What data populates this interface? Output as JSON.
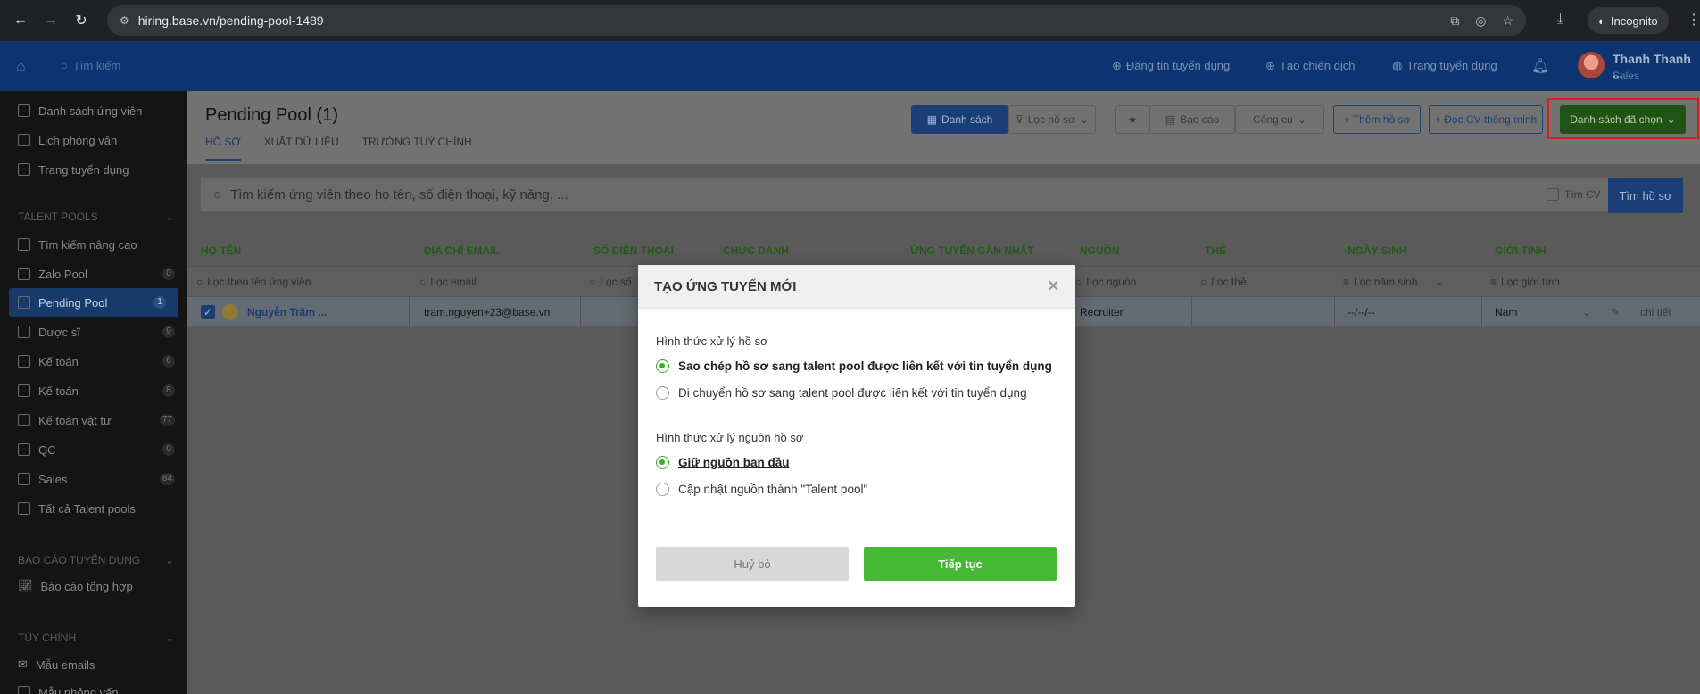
{
  "browser": {
    "url": "hiring.base.vn/pending-pool-1489",
    "incognito_label": "Incognito"
  },
  "header": {
    "search_placeholder": "Tìm kiếm",
    "links": [
      "Đăng tin tuyển dụng",
      "Tạo chiến dịch",
      "Trang tuyển dụng"
    ],
    "user_name": "Thanh Thanh ...",
    "user_role": "Sales"
  },
  "sidebar": {
    "top_items": [
      "Danh sách ứng viên",
      "Lịch phỏng vấn",
      "Trang tuyển dụng"
    ],
    "talent_pools_title": "TALENT POOLS",
    "pools": [
      {
        "label": "Tìm kiếm nâng cao",
        "count": ""
      },
      {
        "label": "Zalo Pool",
        "count": "0"
      },
      {
        "label": "Pending Pool",
        "count": "1"
      },
      {
        "label": "Dược sĩ",
        "count": "9"
      },
      {
        "label": "Kế toán",
        "count": "6"
      },
      {
        "label": "Kế toán",
        "count": "8"
      },
      {
        "label": "Kế toán vật tư",
        "count": "77"
      },
      {
        "label": "QC",
        "count": "0"
      },
      {
        "label": "Sales",
        "count": "84"
      },
      {
        "label": "Tất cả Talent pools",
        "count": ""
      }
    ],
    "reports_title": "BÁO CÁO TUYỂN DỤNG",
    "report_item": "Báo cáo tổng hợp",
    "custom_title": "TÙY CHỈNH",
    "custom_items": [
      "Mẫu emails",
      "Mẫu phỏng vấn"
    ]
  },
  "main": {
    "title": "Pending Pool (1)",
    "tabs": [
      "HỒ SƠ",
      "XUẤT DỮ LIỆU",
      "TRƯỜNG TUỲ CHỈNH"
    ],
    "toolbar": {
      "list": "Danh sách",
      "filter": "Lọc hồ sơ",
      "report": "Báo cáo",
      "tools": "Công cụ",
      "add": "+ Thêm hồ sơ",
      "smart_cv": "+ Đọc CV thông minh",
      "selected": "Danh sách đã chọn"
    },
    "search_placeholder": "Tìm kiếm ứng viên theo họ tên, số điện thoại, kỹ năng, ...",
    "cv_check_label": "Tìm CV",
    "search_button": "Tìm hồ sơ",
    "columns": [
      "HỌ TÊN",
      "ĐỊA CHỈ EMAIL",
      "SỐ ĐIỆN THOẠI",
      "CHỨC DANH",
      "ỨNG TUYỂN GẦN NHẤT",
      "NGUỒN",
      "THẺ",
      "NGÀY SINH",
      "GIỚI TÍNH"
    ],
    "filters": [
      "Lọc theo tên ứng viên",
      "Lọc email",
      "Lọc số",
      "Lọc nguồn",
      "Lọc thẻ",
      "Lọc năm sinh",
      "Lọc giới tính"
    ],
    "row": {
      "name": "Nguyễn Trâm ...",
      "email": "tram.nguyen+23@base.vn",
      "source": "Recruiter",
      "birthday": "--/--/--",
      "gender": "Nam",
      "detail": "chi tiết"
    }
  },
  "modal": {
    "title": "TẠO ỨNG TUYỂN MỚI",
    "group1_label": "Hình thức xử lý hồ sơ",
    "group1_options": [
      "Sao chép hồ sơ sang talent pool được liên kết với tin tuyển dụng",
      "Di chuyển hồ sơ sang talent pool được liên kết với tin tuyển dụng"
    ],
    "group2_label": "Hình thức xử lý nguồn hồ sơ",
    "group2_options": [
      "Giữ nguồn ban đầu",
      "Cập nhật nguồn thành \"Talent pool\""
    ],
    "cancel": "Huỷ bỏ",
    "continue": "Tiếp tục"
  }
}
